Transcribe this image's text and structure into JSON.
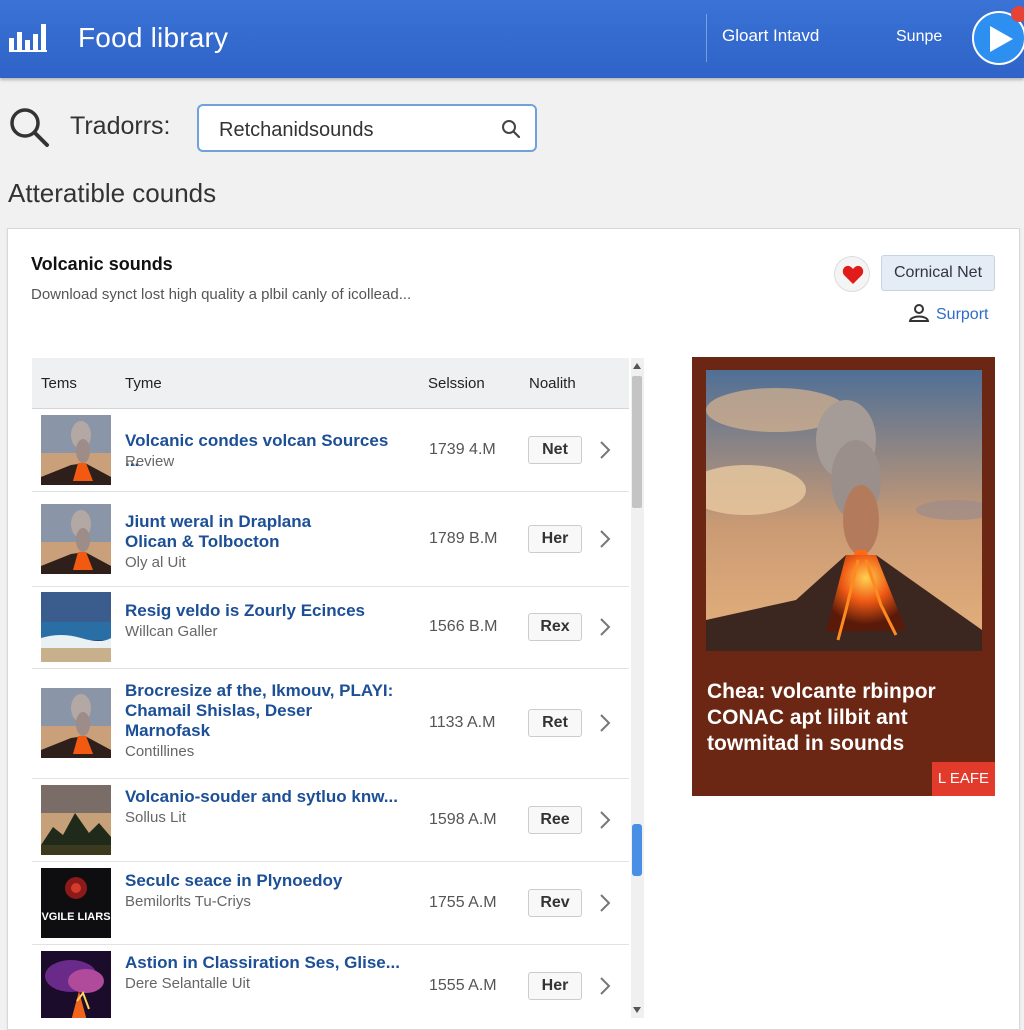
{
  "header": {
    "title": "Food library",
    "link_1": "Gloart Intavd",
    "link_2": "Sunpe"
  },
  "search": {
    "label": "Tradorrs:",
    "value": "Retchanidsounds"
  },
  "section_title": "Atteratible counds",
  "card": {
    "title": "Volcanic sounds",
    "description": "Download synct lost high quality a plbil canly of icollead...",
    "action_button": "Cornical Net",
    "support_link": "Surport"
  },
  "table": {
    "columns": [
      "Tems",
      "Tyme",
      "Selssion",
      "Noalith"
    ],
    "rows": [
      {
        "title_lines": [
          "Volcanic condes volcan Sources ..."
        ],
        "subtitle": "Review",
        "size": "1739 4.M",
        "button": "Net",
        "thumb": "volcano"
      },
      {
        "title_lines": [
          "Jiunt weral in Draplana",
          "Olican & Tolbocton"
        ],
        "subtitle": "Oly al Uit",
        "size": "1789 B.M",
        "button": "Her",
        "thumb": "volcano"
      },
      {
        "title_lines": [
          "Resig veldo is Zourly Ecinces"
        ],
        "subtitle": "Willcan Galler",
        "size": "1566 B.M",
        "button": "Rex",
        "thumb": "ocean"
      },
      {
        "title_lines": [
          "Brocresize af the, Ikmouv, PLAYI:",
          "Chamail Shislas, Deser",
          "Marnofask"
        ],
        "subtitle": "Contillines",
        "size": "1133 A.M",
        "button": "Ret",
        "thumb": "volcano"
      },
      {
        "title_lines": [
          "Volcanio-souder and sytluo knw..."
        ],
        "subtitle": "Sollus Lit",
        "size": "1598 A.M",
        "button": "Ree",
        "thumb": "sunset"
      },
      {
        "title_lines": [
          "Seculc seace in Plynoedoy"
        ],
        "subtitle": "Bemilorlts Tu-Criys",
        "size": "1755 A.M",
        "button": "Rev",
        "thumb": "album"
      },
      {
        "title_lines": [
          "Astion in Classiration Ses, Glise..."
        ],
        "subtitle": "Dere Selantalle Uit",
        "size": "1555 A.M",
        "button": "Her",
        "thumb": "nebula"
      }
    ]
  },
  "promo": {
    "text_lines": [
      "Chea: volcante rbinpor",
      "CONAC apt lilbit ant",
      "towmitad in sounds"
    ],
    "badge": "L EAFE"
  },
  "thumb_text": {
    "album": "VGILE LIARS"
  },
  "colors": {
    "header_blue": "#3168cc",
    "link_blue": "#1c4f96",
    "promo_brown": "#6b2713",
    "badge_red": "#e23a2b",
    "heart_red": "#e11a1a"
  }
}
